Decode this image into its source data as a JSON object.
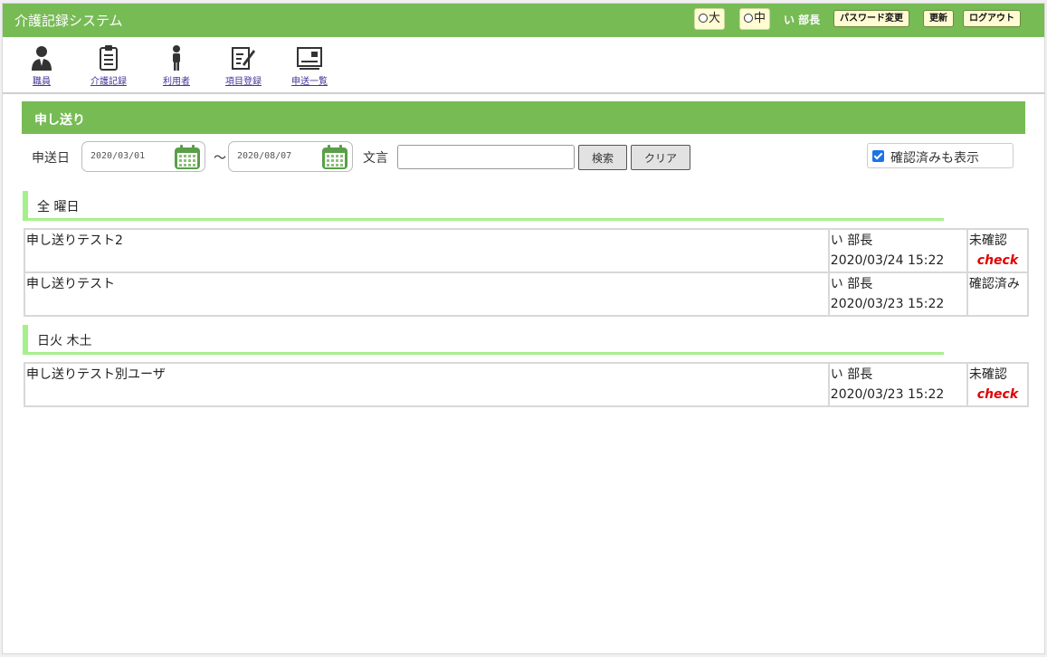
{
  "header": {
    "app_title": "介護記録システム",
    "size_large": "大",
    "size_medium": "中",
    "user_name": "い 部長",
    "password_change": "パスワード変更",
    "refresh": "更新",
    "logout": "ログアウト",
    "bg_color": "#77bb55"
  },
  "nav": {
    "items": [
      {
        "label": "職員",
        "icon": "staff-icon"
      },
      {
        "label": "介護記録",
        "icon": "clipboard-icon"
      },
      {
        "label": "利用者",
        "icon": "person-icon"
      },
      {
        "label": "項目登録",
        "icon": "edit-form-icon"
      },
      {
        "label": "申送一覧",
        "icon": "card-list-icon"
      }
    ]
  },
  "section": {
    "title": "申し送り"
  },
  "search": {
    "date_label": "申送日",
    "date_from": "2020/03/01",
    "tilde": "～",
    "date_to": "2020/08/07",
    "keyword_label": "文言",
    "keyword_value": "",
    "search_button": "検索",
    "clear_button": "クリア",
    "show_confirmed_label": "確認済みも表示",
    "show_confirmed_checked": true
  },
  "groups": [
    {
      "title": "全 曜日",
      "rows": [
        {
          "message": "申し送りテスト2",
          "author": "い 部長",
          "datetime": "2020/03/24 15:22",
          "status": "未確認",
          "action": "check"
        },
        {
          "message": "申し送りテスト",
          "author": "い 部長",
          "datetime": "2020/03/23 15:22",
          "status": "確認済み",
          "action": ""
        }
      ]
    },
    {
      "title": "日火 木土",
      "rows": [
        {
          "message": "申し送りテスト別ユーザ",
          "author": "い 部長",
          "datetime": "2020/03/23 15:22",
          "status": "未確認",
          "action": "check"
        }
      ]
    }
  ]
}
